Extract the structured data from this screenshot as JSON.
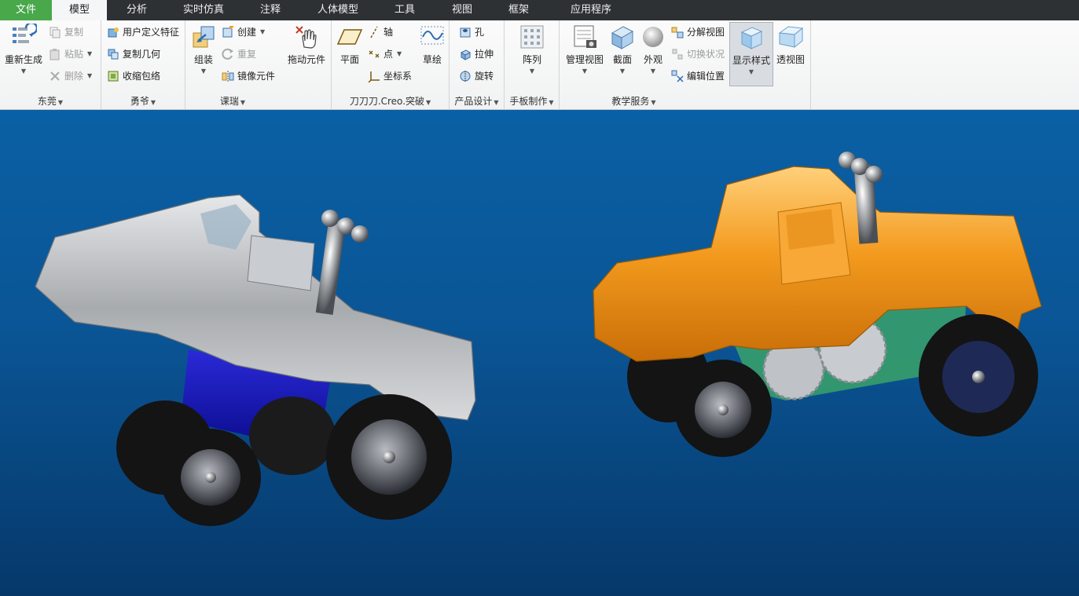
{
  "tabs": [
    "文件",
    "模型",
    "分析",
    "实时仿真",
    "注释",
    "人体模型",
    "工具",
    "视图",
    "框架",
    "应用程序"
  ],
  "active_tab": "模型",
  "groups": {
    "g1": {
      "label": "东莞",
      "regenerate": "重新生成",
      "copy": "复制",
      "paste": "粘贴",
      "delete": "删除"
    },
    "g2": {
      "label": "勇爷",
      "udf": "用户定义特征",
      "copy_geom": "复制几何",
      "shrinkwrap": "收缩包络"
    },
    "g3": {
      "label": "课瑞",
      "assemble": "组装",
      "create": "创建",
      "repeat": "重复",
      "mirror": "镜像元件"
    },
    "g4": {
      "drag": "拖动元件"
    },
    "g5": {
      "label": "刀刀刀.Creo.突破",
      "plane": "平面",
      "axis": "轴",
      "point": "点",
      "csys": "坐标系",
      "sketch": "草绘"
    },
    "g6": {
      "label": "产品设计",
      "hole": "孔",
      "extrude": "拉伸",
      "revolve": "旋转"
    },
    "g7": {
      "label": "手板制作",
      "pattern": "阵列"
    },
    "g8": {
      "label": "教学服务",
      "manage_views": "管理视图",
      "section": "截面",
      "appearance": "外观",
      "explode": "分解视图",
      "toggle_status": "切换状况",
      "edit_position": "编辑位置",
      "display_style": "显示样式",
      "perspective": "透视图"
    }
  },
  "colors": {
    "file_tab": "#48a84a",
    "tabbar": "#2e3133",
    "viewport_top": "#0a60a4",
    "viewport_bottom": "#06386a",
    "truck_left_body": "#b9bcbf",
    "truck_left_chassis": "#1414b4",
    "truck_right_body": "#f39a1e",
    "tire": "#141414"
  }
}
